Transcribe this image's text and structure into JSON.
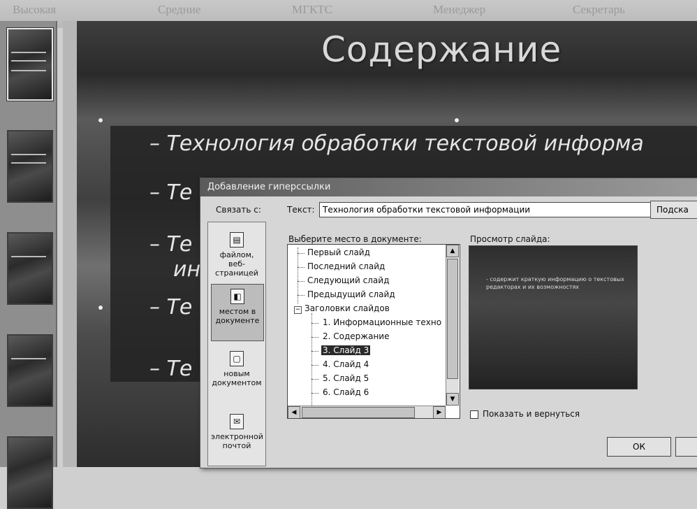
{
  "background_text": [
    "Высокая",
    "Средние",
    "МГКТС",
    "Менеджер",
    "Секретарь"
  ],
  "slide": {
    "title": "Содержание",
    "bullets": [
      "– Технология обработки текстовой информа",
      "– Те",
      "– Те",
      "ин",
      "– Те",
      "– Те"
    ]
  },
  "dialog": {
    "title": "Добавление гиперссылки",
    "link_to_label": "Связать с:",
    "text_label": "Текст:",
    "text_value": "Технология обработки текстовой информации",
    "hint_button": "Подска",
    "link_buttons": [
      {
        "label": "файлом, веб-страницей",
        "icon": "file-web-icon"
      },
      {
        "label": "местом в документе",
        "icon": "place-in-document-icon"
      },
      {
        "label": "новым документом",
        "icon": "new-document-icon"
      },
      {
        "label": "электронной почтой",
        "icon": "email-icon"
      }
    ],
    "tree_label": "Выберите место в документе:",
    "tree_items": [
      "Первый слайд",
      "Последний слайд",
      "Следующий слайд",
      "Предыдущий слайд",
      "Заголовки слайдов",
      "1. Информационные техно",
      "2. Содержание",
      "3. Слайд 3",
      "4. Слайд 4",
      "5. Слайд 5",
      "6. Слайд 6"
    ],
    "preview_label": "Просмотр слайда:",
    "preview_text": "- содержит краткую информацию о текстовых редакторах и их возможностях",
    "show_and_return_label": "Показать и вернуться",
    "ok_label": "ОК"
  }
}
